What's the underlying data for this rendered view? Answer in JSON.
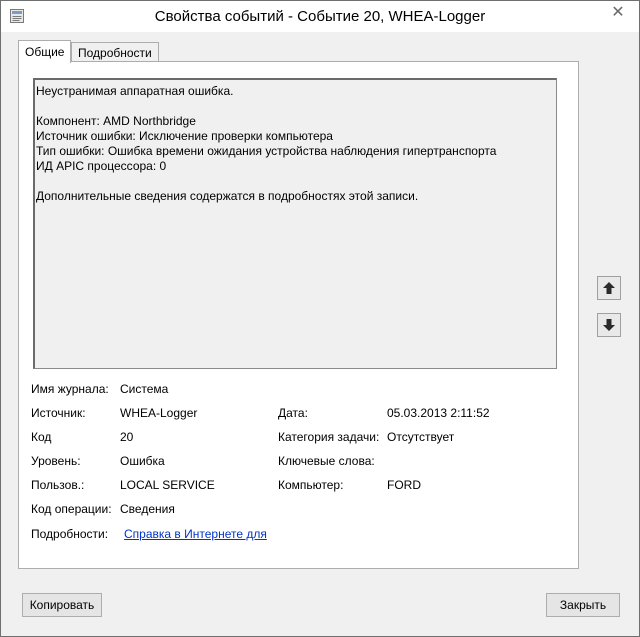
{
  "window": {
    "title": "Свойства событий - Событие 20, WHEA-Logger",
    "close_glyph": "✕"
  },
  "tabs": [
    {
      "label": "Общие",
      "active": true
    },
    {
      "label": "Подробности",
      "active": false
    }
  ],
  "description": {
    "line1": "Неустранимая аппаратная ошибка.",
    "line2": "Компонент: AMD Northbridge",
    "line3": "Источник ошибки: Исключение проверки компьютера",
    "line4": "Тип ошибки: Ошибка времени ожидания устройства наблюдения гипертранспорта",
    "line5": "ИД APIC процессора: 0",
    "line6": "Дополнительные сведения содержатся в подробностях этой записи."
  },
  "fields": {
    "log_name_label": "Имя журнала:",
    "log_name_value": "Система",
    "source_label": "Источник:",
    "source_value": "WHEA-Logger",
    "date_label": "Дата:",
    "date_value": "05.03.2013 2:11:52",
    "code_label": "Код",
    "code_value": "20",
    "task_category_label": "Категория задачи:",
    "task_category_value": "Отсутствует",
    "level_label": "Уровень:",
    "level_value": "Ошибка",
    "keywords_label": "Ключевые слова:",
    "keywords_value": "",
    "user_label": "Пользов.:",
    "user_value": "LOCAL SERVICE",
    "computer_label": "Компьютер:",
    "computer_value": "FORD",
    "opcode_label": "Код операции:",
    "opcode_value": "Сведения",
    "details_label": "Подробности:",
    "details_link": "Справка в Интернете для"
  },
  "buttons": {
    "copy": "Копировать",
    "close": "Закрыть"
  },
  "colors": {
    "link": "#0033cc",
    "window_bg": "#f0f0f0"
  }
}
